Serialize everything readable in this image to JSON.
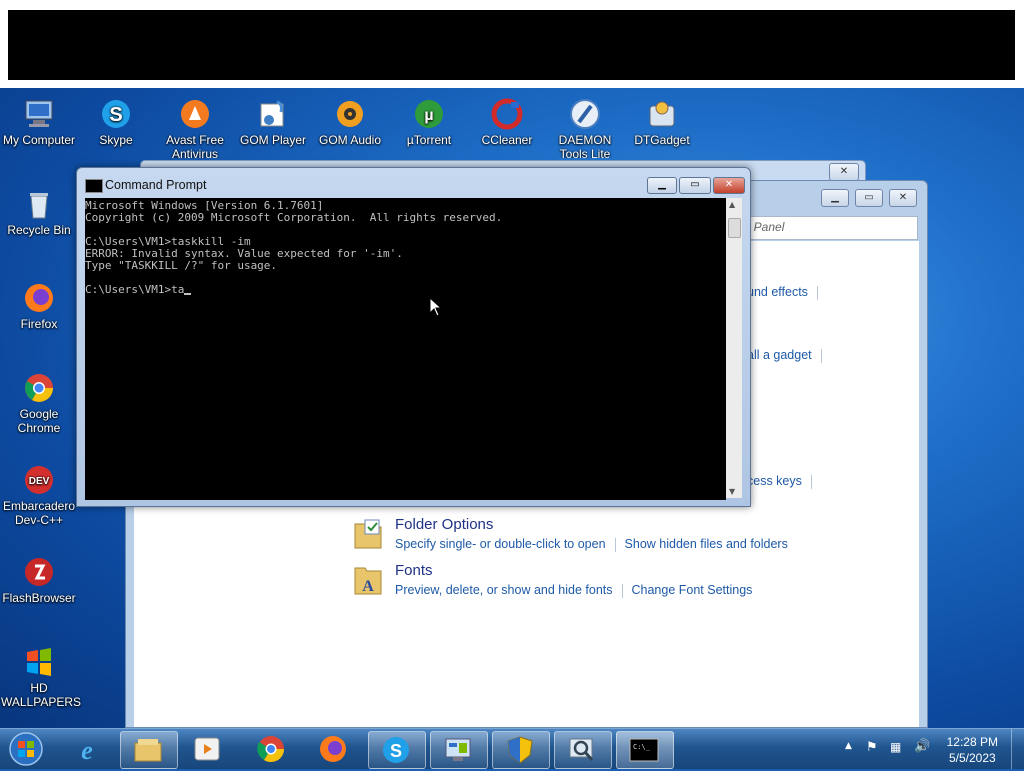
{
  "desktop": {
    "icons": [
      {
        "label": "My Computer"
      },
      {
        "label": "Skype"
      },
      {
        "label": "Avast Free Antivirus"
      },
      {
        "label": "GOM Player"
      },
      {
        "label": "GOM Audio"
      },
      {
        "label": "µTorrent"
      },
      {
        "label": "CCleaner"
      },
      {
        "label": "DAEMON Tools Lite"
      },
      {
        "label": "DTGadget"
      },
      {
        "label": "Recycle Bin"
      },
      {
        "label": "Firefox"
      },
      {
        "label": "Google Chrome"
      },
      {
        "label": "Embarcadero Dev-C++"
      },
      {
        "label": "FlashBrowser"
      },
      {
        "label": "HD WALLPAPERS"
      }
    ]
  },
  "control_panel": {
    "search_placeholder": "ol Panel",
    "partial_links": [
      "und effects",
      "all a gadget",
      "cess keys"
    ],
    "items": [
      {
        "title": "Folder Options",
        "links": [
          "Specify single- or double-click to open",
          "Show hidden files and folders"
        ]
      },
      {
        "title": "Fonts",
        "links": [
          "Preview, delete, or show and hide fonts",
          "Change Font Settings"
        ]
      }
    ]
  },
  "cmd": {
    "title": "Command Prompt",
    "lines": [
      "Microsoft Windows [Version 6.1.7601]",
      "Copyright (c) 2009 Microsoft Corporation.  All rights reserved.",
      "",
      "C:\\Users\\VM1>taskkill -im",
      "ERROR: Invalid syntax. Value expected for '-im'.",
      "Type \"TASKKILL /?\" for usage.",
      "",
      "C:\\Users\\VM1>ta"
    ]
  },
  "taskbar": {
    "time": "12:28 PM",
    "date": "5/5/2023"
  }
}
